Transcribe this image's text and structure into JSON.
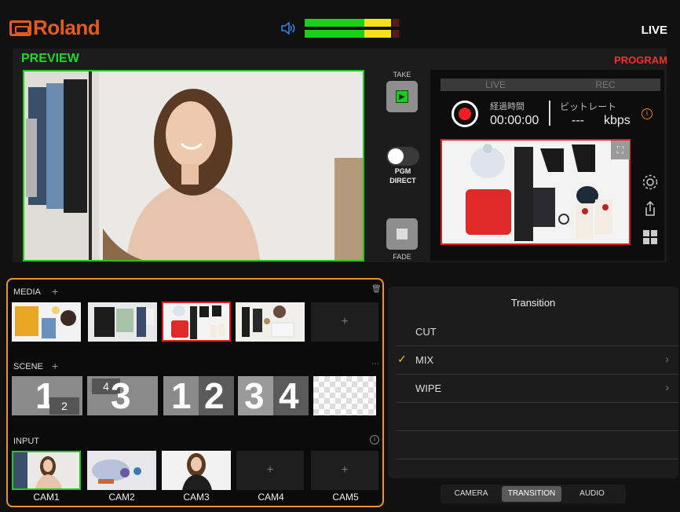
{
  "header": {
    "brand": "Roland",
    "live_label": "LIVE"
  },
  "audio": {
    "level_left": 0.92,
    "level_right": 0.92
  },
  "preview": {
    "label": "PREVIEW"
  },
  "program": {
    "label": "PROGRAM"
  },
  "controls": {
    "take_label": "TAKE",
    "pgm_direct_label_1": "PGM",
    "pgm_direct_label_2": "DIRECT",
    "fade_label": "FADE"
  },
  "stream": {
    "status_live": "LIVE",
    "status_rec": "REC",
    "elapsed_label": "経過時間",
    "elapsed_value": "00:00:00",
    "bitrate_label": "ビットレート",
    "bitrate_value": "---",
    "bitrate_unit": "kbps"
  },
  "media": {
    "label": "MEDIA",
    "add": "+"
  },
  "scene": {
    "label": "SCENE",
    "add": "+",
    "items": [
      "1 2",
      "4 3",
      "1 2",
      "3 4",
      "checker"
    ]
  },
  "input": {
    "label": "INPUT",
    "cams": [
      "CAM1",
      "CAM2",
      "CAM3",
      "CAM4",
      "CAM5"
    ],
    "add": "+"
  },
  "transition": {
    "title": "Transition",
    "items": [
      "CUT",
      "MIX",
      "WIPE"
    ],
    "selected": "MIX"
  },
  "tabs": [
    "CAMERA",
    "TRANSITION",
    "AUDIO"
  ],
  "colors": {
    "accent": "#e55a1e",
    "preview": "#23d62a",
    "program": "#f0322a",
    "highlight": "#e8962a"
  }
}
